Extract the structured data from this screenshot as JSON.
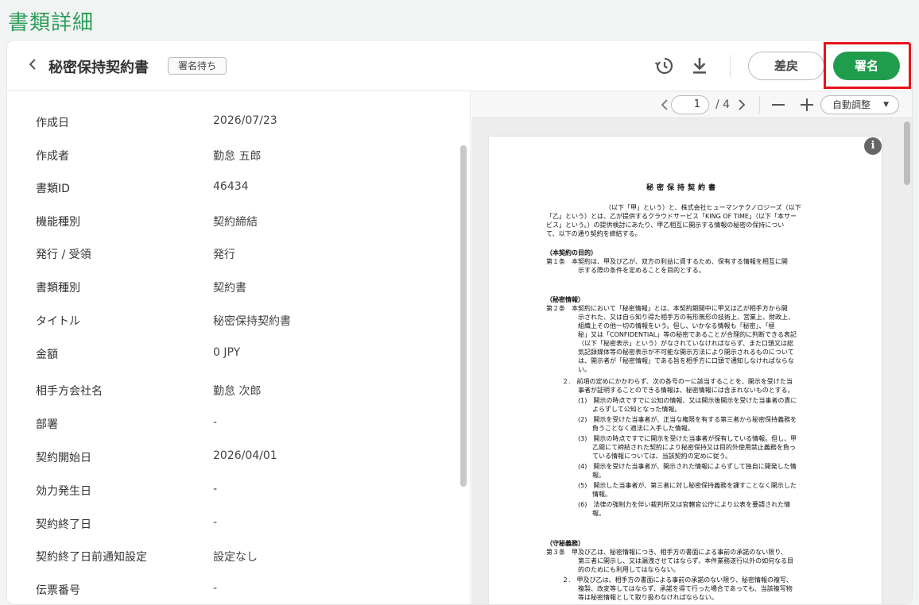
{
  "page": {
    "title": "書類詳細"
  },
  "header": {
    "doc_title": "秘密保持契約書",
    "status_badge": "署名待ち",
    "history_icon": "history-icon",
    "download_icon": "download-icon",
    "return_label": "差戻",
    "sign_label": "署名"
  },
  "fields": [
    {
      "label": "作成日",
      "value": "2026/07/23"
    },
    {
      "label": "作成者",
      "value": "勤怠 五郎"
    },
    {
      "label": "書類ID",
      "value": "46434"
    },
    {
      "label": "機能種別",
      "value": "契約締結"
    },
    {
      "label": "発行 / 受領",
      "value": "発行"
    },
    {
      "label": "書類種別",
      "value": "契約書"
    },
    {
      "label": "タイトル",
      "value": "秘密保持契約書"
    },
    {
      "label": "金額",
      "value": "0 JPY"
    },
    {
      "label": "相手方会社名",
      "value": "勤怠 次郎"
    },
    {
      "label": "部署",
      "value": "-"
    },
    {
      "label": "契約開始日",
      "value": "2026/04/01"
    },
    {
      "label": "効力発生日",
      "value": "-"
    },
    {
      "label": "契約終了日",
      "value": "-"
    },
    {
      "label": "契約終了日前通知設定",
      "value": "設定なし"
    },
    {
      "label": "伝票番号",
      "value": "-"
    }
  ],
  "viewer": {
    "current_page": "1",
    "total_pages": "/ 4",
    "zoom_label": "自動調整"
  },
  "document": {
    "title": "秘密保持契約書",
    "lines": [
      "（以下「甲」という）と、株式会社ヒューマンテクノロジーズ（以下",
      "「乙」という）とは、乙が提供するクラウドサービス「KING OF TIME」（以下「本サー",
      "ビス」という。）の提供検討にあたり、甲乙相互に開示する情報の秘密の保持につい",
      "て、以下の通り契約を締結する。",
      "（本契約の目的）",
      "第１条　本契約は、甲及び乙が、双方の利益に資するため、保有する情報を相互に開",
      "示する際の条件を定めることを目的とする。",
      "（秘密情報）",
      "第２条　本契約において「秘密情報」とは、本契約期間中に甲又は乙が相手方から開",
      "示された、又は自ら知り得た相手方の有形無形の技術上、営業上、財政上、",
      "組織上その他一切の情報をいう。但し、いかなる情報も「秘密」、「極",
      "秘」又は「CONFIDENTIAL」等の秘密であることが合理的に判断できる表記",
      "（以下「秘密表示」という）がなされていなければならず、また口頭又は総",
      "気記録媒体等の秘密表示が不可能な開示方法により開示されるものについて",
      "は、開示者が「秘密情報」である旨を相手方に口頭で通知しなければならな",
      "い。",
      "２.　前項の定めにかかわらず、次の各号の一に該当することを、開示を受けた当",
      "事者が証明することのできる情報は、秘密情報には含まれないものとする。",
      "(1)　開示の時点ですでに公知の情報、又は開示後開示を受けた当事者の責に",
      "よらずして公知となった情報。",
      "(2)　開示を受けた当事者が、正当な権限を有する第三者から秘密保持義務を",
      "負うことなく適法に入手した情報。",
      "(3)　開示の時点ですでに開示を受けた当事者が保有している情報。但し、甲",
      "乙間にて締結された契約により秘密保持又は目的外使用禁止義務を負っ",
      "ている情報については、当該契約の定めに従う。",
      "(4)　開示を受けた当事者が、開示された情報によらずして独自に開発した情",
      "報。",
      "(5)　開示した当事者が、第三者に対し秘密保持義務を課すことなく開示した",
      "情報。",
      "(6)　法律の強制力を伴い裁判所又は官轄官公庁により公表を要請された情",
      "報。",
      "（守秘義務）",
      "第３条　甲及び乙は、秘密情報につき、相手方の書面による事前の承諾のない限り、",
      "第三者に開示し、又は漏洩させてはならず、本件業務遂行以外の如何なる目",
      "的のためにも利用してはならない。",
      "２.　甲及び乙は、相手方の書面による事前の承諾のない限り、秘密情報の複写、",
      "複製、改変等してはならず、承諾を得て行った場合であっても、当該複写物",
      "等は秘密情報として取り扱わなければならない。"
    ]
  }
}
